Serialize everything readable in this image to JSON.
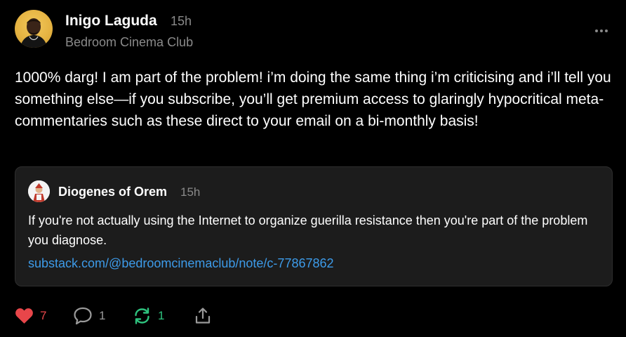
{
  "author": {
    "name": "Inigo Laguda",
    "time": "15h",
    "publication": "Bedroom Cinema Club"
  },
  "body": "1000% darg! I am part of the problem! i’m doing the same thing i’m criticising and i’ll tell you something else—if you subscribe, you’ll get premium access to glaringly hypocritical meta-commentaries such as these direct to your email on a bi-monthly basis!",
  "quote": {
    "author": "Diogenes of Orem",
    "time": "15h",
    "text": "If you're not actually using the Internet to organize guerilla resistance then you're part of the problem you diagnose.",
    "link": "substack.com/@bedroomcinemaclub/note/c-77867862"
  },
  "actions": {
    "likes": "7",
    "comments": "1",
    "restacks": "1"
  },
  "icons": {
    "more": "more-horizontal-icon",
    "like": "heart-icon",
    "comment": "comment-icon",
    "restack": "restack-icon",
    "share": "share-icon"
  },
  "colors": {
    "background": "#000000",
    "card": "#1c1c1c",
    "muted": "#8a8a8a",
    "link": "#3d9be9",
    "like": "#e8464a",
    "restack": "#2ec27e"
  }
}
